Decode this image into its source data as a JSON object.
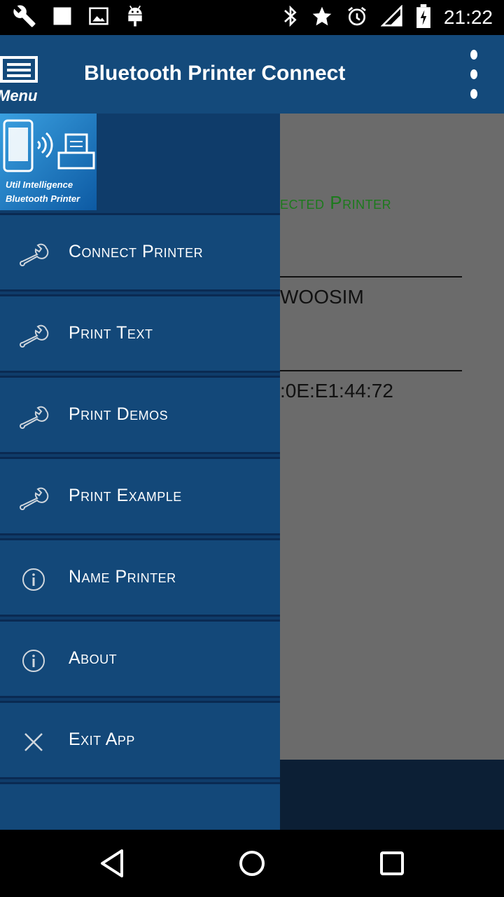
{
  "status_bar": {
    "time": "21:22",
    "left_icons": [
      "wrench-icon",
      "square-icon",
      "image-icon",
      "android-icon"
    ],
    "right_icons": [
      "bluetooth-icon",
      "star-icon",
      "alarm-icon",
      "signal-icon",
      "battery-charging-icon"
    ]
  },
  "app_bar": {
    "menu_label": "Menu",
    "title": "Bluetooth Printer Connect",
    "overflow_icon": "more-vert-icon"
  },
  "drawer": {
    "logo_lines": [
      "Util Intelligence",
      "Bluetooth Printer"
    ],
    "items": [
      {
        "label": "Connect Printer",
        "icon": "wrench-icon"
      },
      {
        "label": "Print Text",
        "icon": "wrench-icon"
      },
      {
        "label": "Print Demos",
        "icon": "wrench-icon"
      },
      {
        "label": "Print Example",
        "icon": "wrench-icon"
      },
      {
        "label": "Name Printer",
        "icon": "info-icon"
      },
      {
        "label": "About",
        "icon": "info-icon"
      },
      {
        "label": "Exit App",
        "icon": "close-icon"
      }
    ]
  },
  "content": {
    "connected_label_partial": "ected Printer",
    "printer_name_partial": "WOOSIM",
    "printer_address_partial": ":0E:E1:44:72"
  },
  "nav_bar": {
    "buttons": [
      "back-icon",
      "home-icon",
      "recents-icon"
    ]
  },
  "colors": {
    "app_bar": "#144a7b",
    "drawer_item": "#134879",
    "divider": "#0a2a52",
    "accent_green": "#1c7a1c",
    "scrim": "#6b6b6b"
  }
}
